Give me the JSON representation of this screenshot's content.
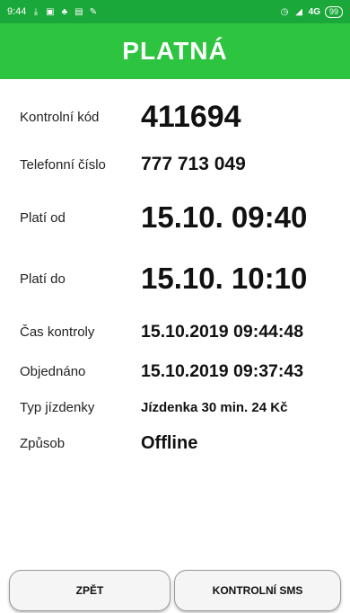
{
  "status_bar": {
    "time": "9:44",
    "network": "4G",
    "battery": "99"
  },
  "header": {
    "title": "PLATNÁ",
    "color": "#2dc43f"
  },
  "details": [
    {
      "label": "Kontrolní kód",
      "value": "411694"
    },
    {
      "label": "Telefonní číslo",
      "value": "777 713 049"
    },
    {
      "label": "Platí od",
      "value": "15.10. 09:40"
    },
    {
      "label": "Platí do",
      "value": "15.10. 10:10"
    },
    {
      "label": "Čas kontroly",
      "value": "15.10.2019 09:44:48"
    },
    {
      "label": "Objednáno",
      "value": "15.10.2019 09:37:43"
    },
    {
      "label": "Typ jízdenky",
      "value": "Jízdenka 30 min. 24 Kč"
    },
    {
      "label": "Způsob",
      "value": "Offline"
    }
  ],
  "buttons": {
    "back": "ZPĚT",
    "control_sms": "KONTROLNÍ SMS"
  }
}
